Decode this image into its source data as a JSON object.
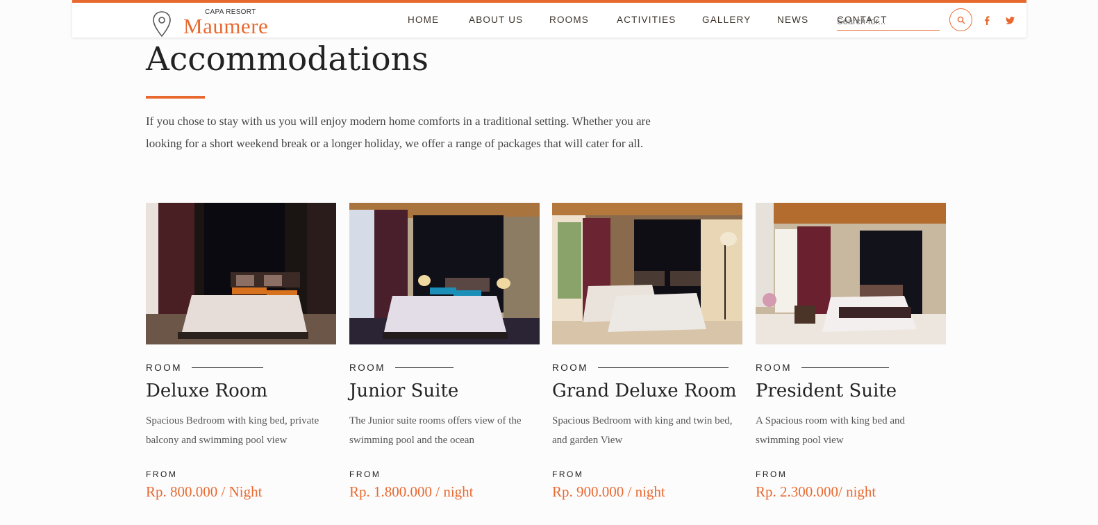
{
  "header": {
    "brand_small": "CAPA RESORT",
    "brand_name": "Maumere",
    "nav": [
      "HOME",
      "ABOUT US",
      "ROOMS",
      "ACTIVITIES",
      "GALLERY",
      "NEWS",
      "CONTACT"
    ],
    "search_placeholder": "Search for...",
    "icons": [
      "map-pin-icon",
      "search-icon",
      "facebook-icon",
      "twitter-icon"
    ],
    "accent_color": "#e8692f"
  },
  "intro": {
    "title": "Accommodations",
    "text": "If you chose to stay with us you will enjoy modern home comforts in a traditional setting. Whether you are looking for a short weekend break or a longer holiday, we offer a range of packages that will cater for all."
  },
  "rooms": [
    {
      "eyebrow": "ROOM",
      "name": "Deluxe Room",
      "description": "Spacious Bedroom with king bed, private balcony and swimming pool view",
      "from_label": "FROM",
      "price": "Rp. 800.000 / Night"
    },
    {
      "eyebrow": "ROOM",
      "name": "Junior Suite",
      "description": "The Junior suite rooms offers view of the swimming pool and the ocean",
      "from_label": "FROM",
      "price": "Rp. 1.800.000 / night"
    },
    {
      "eyebrow": "ROOM",
      "name": "Grand Deluxe Room",
      "description": "Spacious Bedroom with king and twin bed, and garden View",
      "from_label": "FROM",
      "price": "Rp. 900.000 / night"
    },
    {
      "eyebrow": "ROOM",
      "name": "President Suite",
      "description": "A Spacious room with king bed and swimming pool view",
      "from_label": "FROM",
      "price": "Rp. 2.300.000/ night"
    }
  ]
}
